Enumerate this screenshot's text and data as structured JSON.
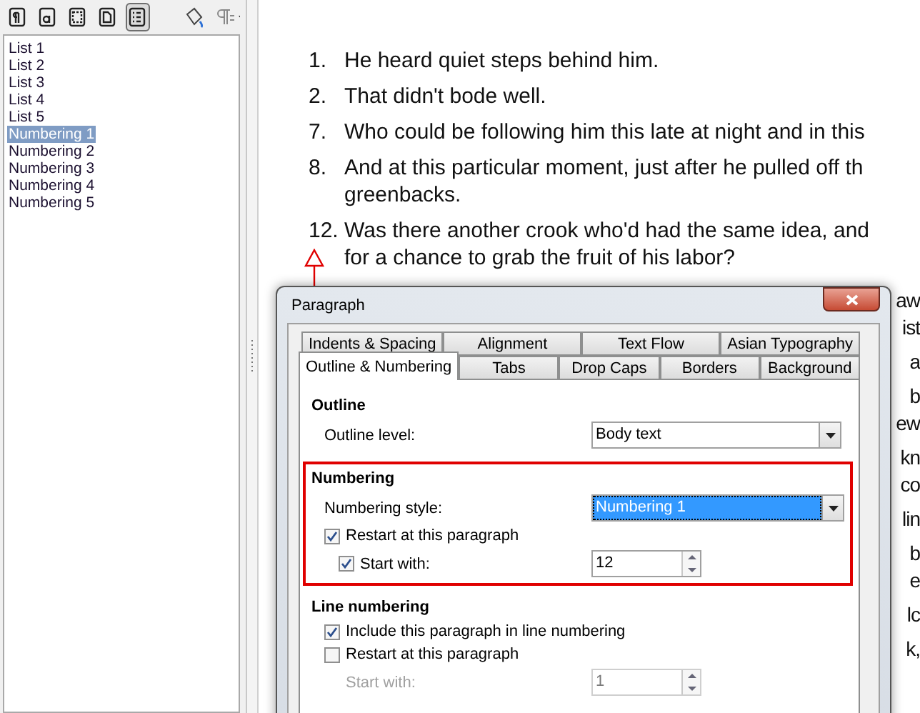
{
  "sidebar": {
    "toolbar": [
      {
        "kind": "paragraph-styles",
        "selected": false
      },
      {
        "kind": "character-styles",
        "selected": false
      },
      {
        "kind": "frame-styles",
        "selected": false
      },
      {
        "kind": "page-styles",
        "selected": false
      },
      {
        "kind": "list-styles",
        "selected": true
      },
      {
        "kind": "fill-format",
        "selected": false
      },
      {
        "kind": "new-style",
        "selected": false
      }
    ],
    "styles": [
      {
        "label": "List 1",
        "selected": false
      },
      {
        "label": "List 2",
        "selected": false
      },
      {
        "label": "List 3",
        "selected": false
      },
      {
        "label": "List 4",
        "selected": false
      },
      {
        "label": "List 5",
        "selected": false
      },
      {
        "label": "Numbering 1",
        "selected": true
      },
      {
        "label": "Numbering 2",
        "selected": false
      },
      {
        "label": "Numbering 3",
        "selected": false
      },
      {
        "label": "Numbering 4",
        "selected": false
      },
      {
        "label": "Numbering 5",
        "selected": false
      }
    ]
  },
  "document": {
    "items": [
      {
        "number": "1.",
        "lines": [
          "He heard quiet steps behind him."
        ]
      },
      {
        "number": "2.",
        "lines": [
          "That didn't bode well."
        ]
      },
      {
        "number": "7.",
        "lines": [
          "Who could be following him this late at night and in this"
        ]
      },
      {
        "number": "8.",
        "lines": [
          "And at this particular moment, just after he pulled off th",
          "greenbacks."
        ]
      },
      {
        "number": "12.",
        "lines": [
          "Was there another crook who'd had the same idea, and",
          "for a chance to grab the fruit of his labor?"
        ]
      }
    ],
    "edge_fragments": [
      [
        "aw",
        "ist"
      ],
      [
        "a"
      ],
      [
        "b",
        "ew"
      ],
      [
        "kn",
        "co"
      ],
      [
        "lin"
      ],
      [
        "b",
        "e"
      ],
      [
        "lc"
      ],
      [
        "k,"
      ]
    ]
  },
  "dialog": {
    "title": "Paragraph",
    "tab_rows": [
      [
        {
          "label": "Indents & Spacing",
          "selected": false
        },
        {
          "label": "Alignment",
          "selected": false
        },
        {
          "label": "Text Flow",
          "selected": false
        },
        {
          "label": "Asian Typography",
          "selected": false
        }
      ],
      [
        {
          "label": "Outline & Numbering",
          "selected": true
        },
        {
          "label": "Tabs",
          "selected": false
        },
        {
          "label": "Drop Caps",
          "selected": false
        },
        {
          "label": "Borders",
          "selected": false
        },
        {
          "label": "Background",
          "selected": false
        }
      ]
    ],
    "sections": [
      {
        "heading": "Outline",
        "annotated": false,
        "rows": [
          {
            "kind": "dropdown",
            "label": "Outline level:",
            "value": "Body text",
            "focused": false
          }
        ]
      },
      {
        "heading": "Numbering",
        "annotated": true,
        "rows": [
          {
            "kind": "dropdown",
            "label": "Numbering style:",
            "value": "Numbering 1",
            "focused": true
          },
          {
            "kind": "checkbox",
            "label": "Restart at this paragraph",
            "checked": true
          },
          {
            "kind": "checkbox-spin",
            "label": "Start with:",
            "checked": true,
            "value": "12",
            "disabled": false
          }
        ]
      },
      {
        "heading": "Line numbering",
        "annotated": false,
        "rows": [
          {
            "kind": "checkbox",
            "label": "Include this paragraph in line numbering",
            "checked": true
          },
          {
            "kind": "checkbox",
            "label": "Restart at this paragraph",
            "checked": false
          },
          {
            "kind": "spin",
            "label": "Start with:",
            "value": "1",
            "disabled": true
          }
        ]
      }
    ]
  }
}
